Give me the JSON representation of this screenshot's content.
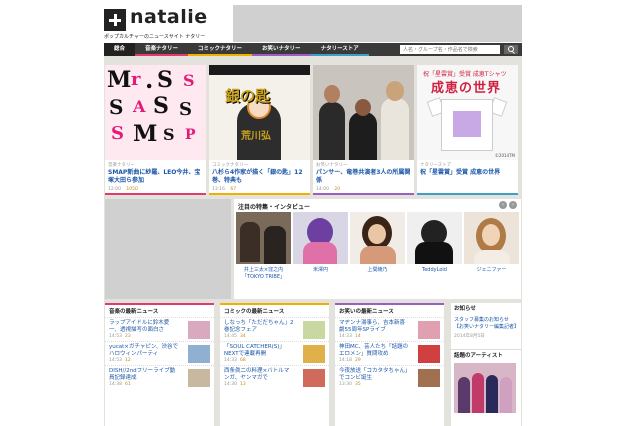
{
  "header": {
    "logo_text": "natalie",
    "tagline": "ポップカルチャーのニュースサイト ナタリー"
  },
  "nav": {
    "items": [
      {
        "label": "総合",
        "color": "#222222"
      },
      {
        "label": "音楽ナタリー",
        "color": "#e23a6a"
      },
      {
        "label": "コミックナタリー",
        "color": "#f0b000"
      },
      {
        "label": "お笑いナタリー",
        "color": "#9a5fc0"
      },
      {
        "label": "ナタリーストア",
        "color": "#3aa0c8"
      }
    ],
    "search_placeholder": "人名・グループ名・作品名で検索"
  },
  "features": [
    {
      "category": "音楽ナタリー",
      "title": "SMAP新曲に紗羅、LEO今井、宝塚大田ら参加",
      "time": "12:00",
      "count": "1050",
      "color": "#e23a6a"
    },
    {
      "category": "コミックナタリー",
      "title": "八杉ら4作家が描く「銀の匙」12巻、特典も",
      "time": "13:16",
      "count": "67",
      "color": "#f0b000"
    },
    {
      "category": "お笑いナタリー",
      "title": "パンサー、竜巻共演者3人の所属関係",
      "time": "14:00",
      "count": "20",
      "color": "#9a5fc0"
    },
    {
      "category": "ナタリーストア",
      "title": "祝「星雲賞」受賞 成恵の世界",
      "time": "",
      "count": "",
      "color": "#3aa0c8"
    }
  ],
  "feature_images": {
    "manga_title": "銀の匙",
    "manga_sub": "荒川弘",
    "shirt_header": "祝「星雲賞」受賞 成恵Tシャツ",
    "shirt_big": "成恵の世界",
    "shirt_credit": "©2014TM"
  },
  "pickup": {
    "title": "注目の特集・インタビュー",
    "items": [
      {
        "label": "井上三太×窪之内「TOKYO TRIBE」"
      },
      {
        "label": "米澤円"
      },
      {
        "label": "上間綾乃"
      },
      {
        "label": "TeddyLoid"
      },
      {
        "label": "ジェニファー"
      }
    ]
  },
  "news": [
    {
      "heading": "音楽の最新ニュース",
      "color": "#e23a6a",
      "items": [
        {
          "title": "ラップアイドルに鈴木愛一、透視描写の面白さ",
          "time": "14:53",
          "count": "23"
        },
        {
          "title": "yucat×ガチャピン、渋谷でハロウィンパーティ",
          "time": "14:53",
          "count": "12"
        },
        {
          "title": "DISH//2ndフリーライブ動員記録達成",
          "time": "14:38",
          "count": "61"
        }
      ]
    },
    {
      "heading": "コミックの最新ニュース",
      "color": "#f0b000",
      "items": [
        {
          "title": "しなっち「ただだちゃん」2巻記念フェア",
          "time": "14:45",
          "count": "34"
        },
        {
          "title": "「SOUL CATCHER(S)」NEXTで連載再開",
          "time": "14:33",
          "count": "68"
        },
        {
          "title": "西条眞二の料理×バトルマンガ、ヤンマガで",
          "time": "14:30",
          "count": "13"
        }
      ]
    },
    {
      "heading": "お笑いの最新ニュース",
      "color": "#9a5fc0",
      "items": [
        {
          "title": "マヂンナ湯事ら、吉本新喜劇55周年SPライブ",
          "time": "14:33",
          "count": "14"
        },
        {
          "title": "神田MC、芸人たち「話題のエロメン」質問攻め",
          "time": "14:18",
          "count": "29"
        },
        {
          "title": "今夜放送「コカタタちゃん」でコンビ誕生",
          "time": "13:30",
          "count": "35"
        }
      ]
    }
  ],
  "notice": {
    "heading": "お知らせ",
    "body": "スタッフ募集のお知らせ【お笑いナタリー編集記者】",
    "date": "2014年8月5日",
    "artist_heading": "話題のアーティスト"
  }
}
